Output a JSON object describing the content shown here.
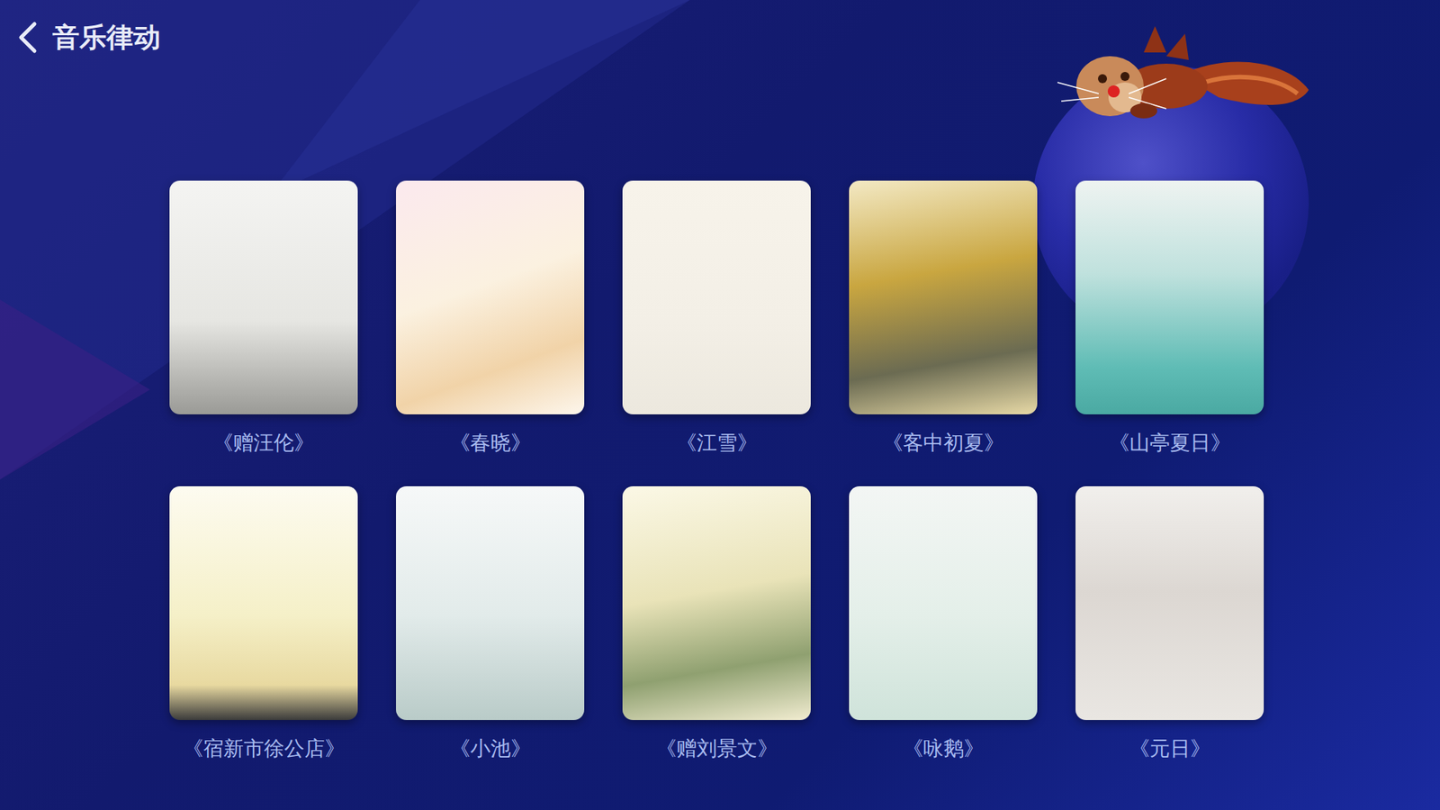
{
  "header": {
    "title": "音乐律动"
  },
  "poems": [
    {
      "title": "《赠汪伦》"
    },
    {
      "title": "《春晓》"
    },
    {
      "title": "《江雪》"
    },
    {
      "title": "《客中初夏》"
    },
    {
      "title": "《山亭夏日》"
    },
    {
      "title": "《宿新市徐公店》"
    },
    {
      "title": "《小池》"
    },
    {
      "title": "《赠刘景文》"
    },
    {
      "title": "《咏鹅》"
    },
    {
      "title": "《元日》"
    }
  ]
}
